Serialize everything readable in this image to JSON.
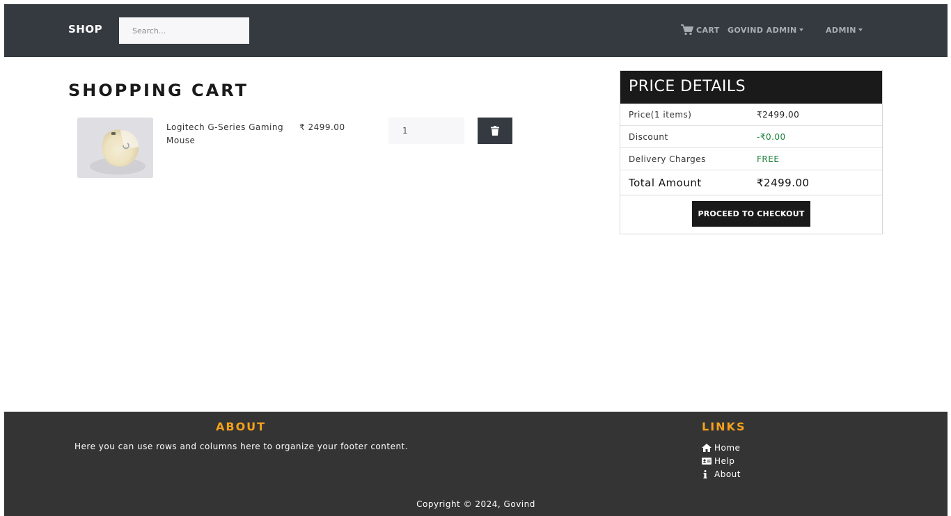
{
  "navbar": {
    "brand": "SHOP",
    "search_placeholder": "Search...",
    "cart_label": "CART",
    "user_menu": "GOVIND ADMIN",
    "admin_menu": "ADMIN"
  },
  "cart": {
    "title": "SHOPPING CART",
    "items": [
      {
        "name": "Logitech G-Series Gaming Mouse",
        "price": "₹ 2499.00",
        "quantity": "1"
      }
    ]
  },
  "price_details": {
    "title": "PRICE DETAILS",
    "price_label": "Price(1 items)",
    "price_value": "₹2499.00",
    "discount_label": "Discount",
    "discount_value": "-₹0.00",
    "delivery_label": "Delivery Charges",
    "delivery_value": "FREE",
    "total_label": "Total Amount",
    "total_value": "₹2499.00",
    "checkout_label": "PROCEED TO CHECKOUT"
  },
  "footer": {
    "about_title": "ABOUT",
    "about_text": "Here you can use rows and columns here to organize your footer content.",
    "links_title": "LINKS",
    "links": [
      {
        "label": "Home",
        "icon": "home-icon"
      },
      {
        "label": "Help",
        "icon": "id-card-icon"
      },
      {
        "label": "About",
        "icon": "info-icon"
      }
    ],
    "copyright": "Copyright © 2024, Govind"
  },
  "colors": {
    "navbar_bg": "#343a40",
    "footer_bg": "#343434",
    "accent_orange": "#f5a11a",
    "green": "#188038",
    "dark": "#1a1a1a"
  }
}
